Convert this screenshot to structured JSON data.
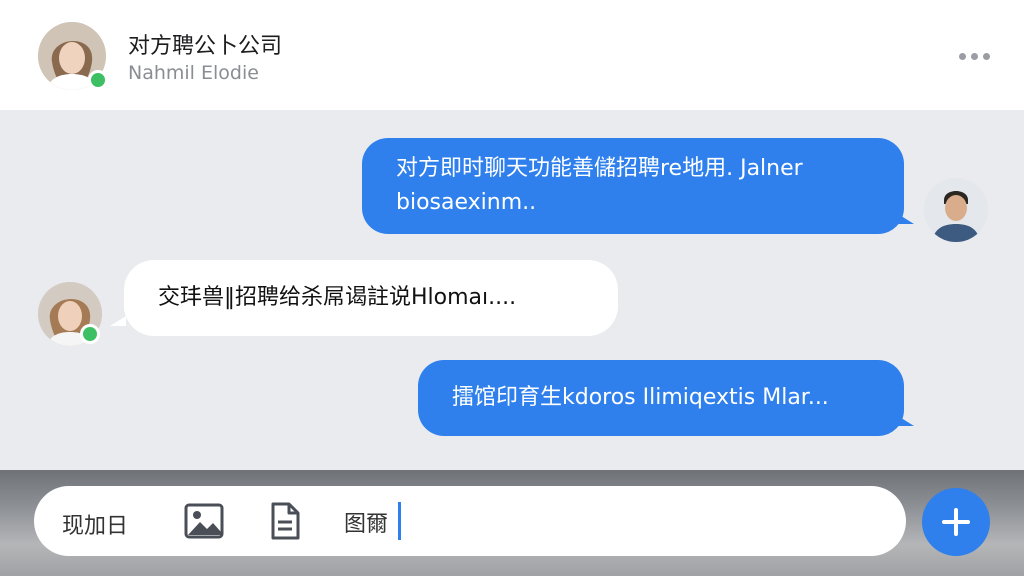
{
  "header": {
    "contact_name": "对方聘公卜公司",
    "contact_subtitle": "Nahmil Elodie",
    "more_icon": "more-horizontal-icon"
  },
  "messages": [
    {
      "direction": "outgoing",
      "text": "对方即时聊天功能善儲招聘re地用. Jalner biosaexinm.."
    },
    {
      "direction": "incoming",
      "text": "交玤兽‖招聘给杀屌谒註说Hlomaı...."
    },
    {
      "direction": "outgoing",
      "text": "擂馆印育生kdoros Ilimiqextis Mlar..."
    }
  ],
  "composer": {
    "label": "现加日",
    "input_value": "图爾",
    "icons": [
      "image-icon",
      "file-icon",
      "plus-icon"
    ]
  },
  "colors": {
    "accent": "#2f80ed",
    "online": "#3cc063",
    "chat_bg": "#e9ebee"
  }
}
